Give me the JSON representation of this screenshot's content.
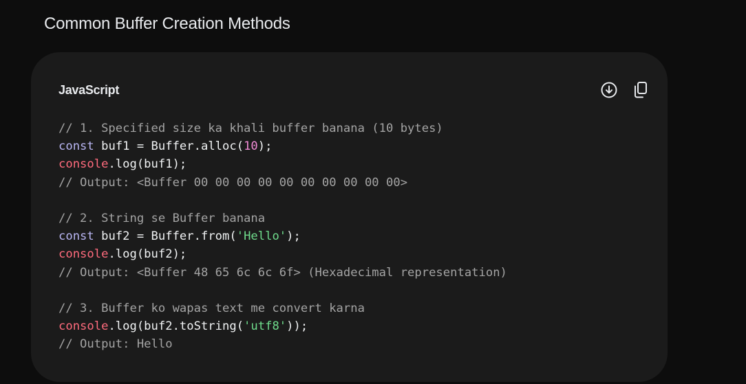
{
  "heading": "Common Buffer Creation Methods",
  "code_block": {
    "language_label": "JavaScript",
    "actions": [
      {
        "name": "download",
        "icon": "download-circle-icon"
      },
      {
        "name": "copy",
        "icon": "copy-icon"
      }
    ],
    "colors": {
      "background": "#1b1b1b",
      "comment": "#a4a4a4",
      "keyword": "#b9b6f3",
      "builtin": "#ff6b7d",
      "number": "#f28bd6",
      "string": "#6fdc8c",
      "text": "#f1f3f4"
    },
    "lines": [
      [
        {
          "t": "comment",
          "v": "// 1. Specified size ka khali buffer banana (10 bytes)"
        }
      ],
      [
        {
          "t": "keyword",
          "v": "const"
        },
        {
          "t": "plain",
          "v": " buf1 = Buffer.alloc("
        },
        {
          "t": "number",
          "v": "10"
        },
        {
          "t": "plain",
          "v": ");"
        }
      ],
      [
        {
          "t": "builtin",
          "v": "console"
        },
        {
          "t": "plain",
          "v": ".log(buf1);"
        }
      ],
      [
        {
          "t": "comment",
          "v": "// Output: <Buffer 00 00 00 00 00 00 00 00 00 00>"
        }
      ],
      [],
      [
        {
          "t": "comment",
          "v": "// 2. String se Buffer banana"
        }
      ],
      [
        {
          "t": "keyword",
          "v": "const"
        },
        {
          "t": "plain",
          "v": " buf2 = Buffer.from("
        },
        {
          "t": "string",
          "v": "'Hello'"
        },
        {
          "t": "plain",
          "v": ");"
        }
      ],
      [
        {
          "t": "builtin",
          "v": "console"
        },
        {
          "t": "plain",
          "v": ".log(buf2);"
        }
      ],
      [
        {
          "t": "comment",
          "v": "// Output: <Buffer 48 65 6c 6c 6f> (Hexadecimal representation)"
        }
      ],
      [],
      [
        {
          "t": "comment",
          "v": "// 3. Buffer ko wapas text me convert karna"
        }
      ],
      [
        {
          "t": "builtin",
          "v": "console"
        },
        {
          "t": "plain",
          "v": ".log(buf2.toString("
        },
        {
          "t": "string",
          "v": "'utf8'"
        },
        {
          "t": "plain",
          "v": "));"
        }
      ],
      [
        {
          "t": "comment",
          "v": "// Output: Hello"
        }
      ]
    ]
  }
}
